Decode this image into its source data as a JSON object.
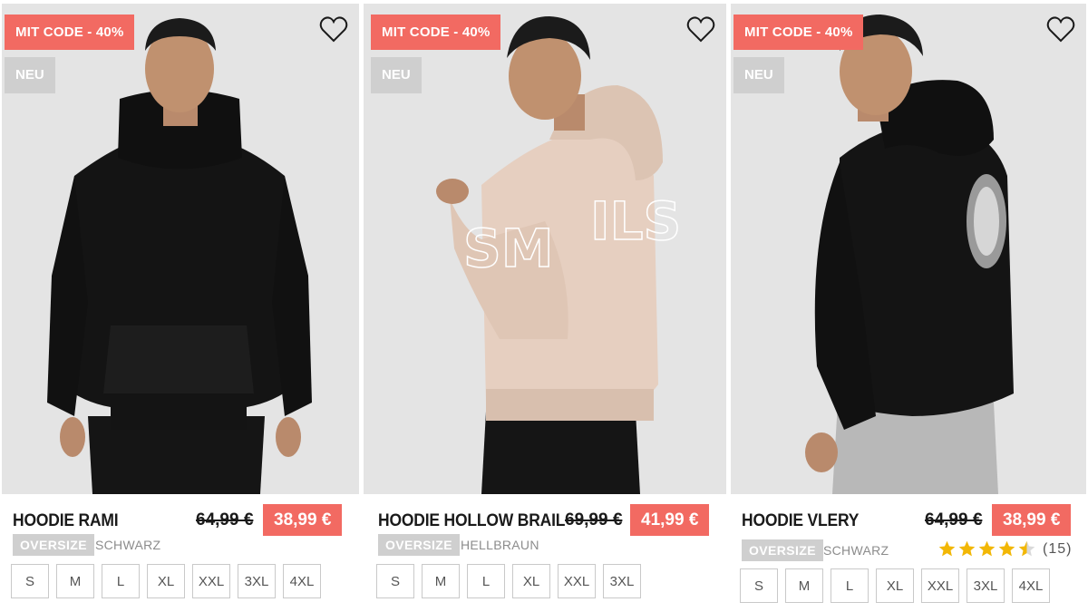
{
  "colors": {
    "sale_red": "#f26a62",
    "badge_grey": "#cfcfcf",
    "background": "#e4e4e4"
  },
  "products": [
    {
      "badge_sale": "MIT CODE - 40%",
      "badge_new": "NEU",
      "title": "HOODIE RAMI",
      "old_price": "64,99 €",
      "new_price": "38,99 €",
      "fit": "OVERSIZE",
      "color": "SCHWARZ",
      "sizes": [
        "S",
        "M",
        "L",
        "XL",
        "XXL",
        "3XL",
        "4XL"
      ],
      "icon": "heart-icon"
    },
    {
      "badge_sale": "MIT CODE - 40%",
      "badge_new": "NEU",
      "title": "HOODIE HOLLOW BRAIL",
      "old_price": "69,99 €",
      "new_price": "41,99 €",
      "fit": "OVERSIZE",
      "color": "HELLBRAUN",
      "sizes": [
        "S",
        "M",
        "L",
        "XL",
        "XXL",
        "3XL"
      ],
      "icon": "heart-icon"
    },
    {
      "badge_sale": "MIT CODE - 40%",
      "badge_new": "NEU",
      "title": "HOODIE VLERY",
      "old_price": "64,99 €",
      "new_price": "38,99 €",
      "fit": "OVERSIZE",
      "color": "SCHWARZ",
      "rating": 4.5,
      "rating_count": "(15)",
      "sizes": [
        "S",
        "M",
        "L",
        "XL",
        "XXL",
        "3XL",
        "4XL"
      ],
      "icon": "heart-icon"
    }
  ]
}
